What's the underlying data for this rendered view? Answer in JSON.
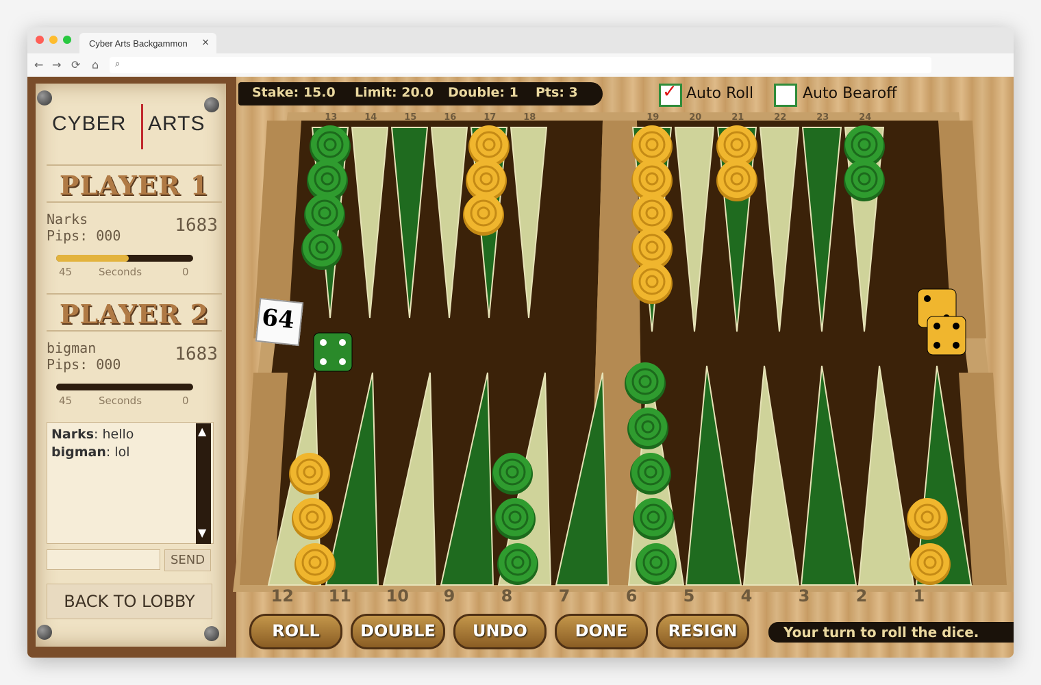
{
  "browser": {
    "tab_title": "Cyber Arts Backgammon",
    "tab_close": "×",
    "nav_back": "←",
    "nav_forward": "→",
    "reload": "⟳",
    "home": "⌂",
    "search_icon": "⌕"
  },
  "sidebar": {
    "logo_left": "CYBER",
    "logo_right": "ARTS",
    "player1": {
      "title": "PLAYER 1",
      "name": "Narks",
      "pips": "Pips: 000",
      "rating": "1683",
      "timer_fraction": 0.53,
      "timer_left": "45",
      "timer_mid": "Seconds",
      "timer_right": "0"
    },
    "player2": {
      "title": "PLAYER 2",
      "name": "bigman",
      "pips": "Pips: 000",
      "rating": "1683",
      "timer_fraction": 0,
      "timer_left": "45",
      "timer_mid": "Seconds",
      "timer_right": "0"
    },
    "chat": [
      {
        "user": "Narks",
        "text": ": hello"
      },
      {
        "user": "bigman",
        "text": ": lol"
      }
    ],
    "send_label": "SEND",
    "lobby_label": "BACK TO LOBBY"
  },
  "info": {
    "stake": "Stake: 15.0",
    "limit": "Limit: 20.0",
    "double": "Double: 1",
    "pts": "Pts: 3"
  },
  "options": {
    "auto_roll": {
      "label": "Auto Roll",
      "checked": true
    },
    "auto_bearoff": {
      "label": "Auto Bearoff",
      "checked": false
    }
  },
  "board": {
    "top_numbers": [
      "13",
      "14",
      "15",
      "16",
      "17",
      "18",
      "19",
      "20",
      "21",
      "22",
      "23",
      "24"
    ],
    "bottom_numbers": [
      "12",
      "11",
      "10",
      "9",
      "8",
      "7",
      "6",
      "5",
      "4",
      "3",
      "2",
      "1"
    ],
    "cube_value": "64",
    "dice_green": 4,
    "dice_yellow": [
      2,
      4
    ],
    "colors": {
      "green_checker": "#2f9c2f",
      "yellow_checker": "#f0b62e",
      "board_dark": "#3b2209",
      "triangle_dark": "#1f6b1f",
      "triangle_light": "#cfd39a"
    },
    "checkers": {
      "top": {
        "13": {
          "color": "green",
          "count": 4
        },
        "17": {
          "color": "yellow",
          "count": 3
        },
        "19": {
          "color": "yellow",
          "count": 5
        },
        "21": {
          "color": "yellow",
          "count": 2
        },
        "24": {
          "color": "green",
          "count": 2
        }
      },
      "bottom": {
        "12": {
          "color": "yellow",
          "count": 3
        },
        "8": {
          "color": "green",
          "count": 3
        },
        "6": {
          "color": "green",
          "count": 5
        },
        "1": {
          "color": "yellow",
          "count": 2
        }
      }
    }
  },
  "buttons": [
    "ROLL",
    "DOUBLE",
    "UNDO",
    "DONE",
    "RESIGN"
  ],
  "status": "Your turn to roll the dice."
}
